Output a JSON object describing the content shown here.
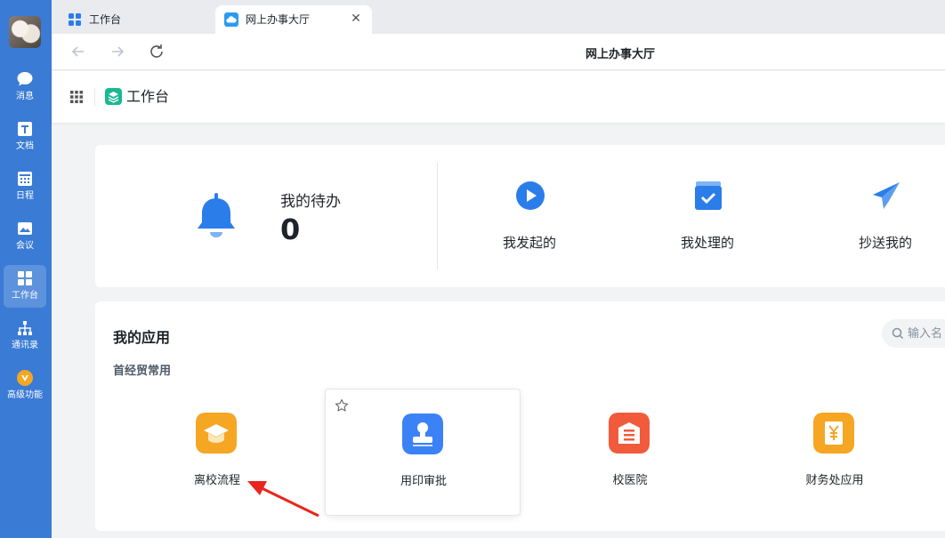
{
  "rail": {
    "items": [
      {
        "label": "消息",
        "icon": "chat-bubble-icon"
      },
      {
        "label": "文档",
        "icon": "document-icon"
      },
      {
        "label": "日程",
        "icon": "calendar-icon"
      },
      {
        "label": "会议",
        "icon": "meeting-icon"
      },
      {
        "label": "工作台",
        "icon": "workbench-grid-icon"
      },
      {
        "label": "通讯录",
        "icon": "org-chart-icon"
      },
      {
        "label": "高级功能",
        "icon": "premium-badge-icon"
      }
    ],
    "active_label": "工作台"
  },
  "tabs": [
    {
      "label": "工作台",
      "icon": "workbench-grid-icon"
    },
    {
      "label": "网上办事大厅",
      "icon": "cloud-icon"
    }
  ],
  "navbar": {
    "page_title": "网上办事大厅"
  },
  "header": {
    "title": "工作台"
  },
  "todo": {
    "label": "我的待办",
    "count": "0"
  },
  "quick_actions": [
    {
      "label": "我发起的",
      "icon": "play-circle-icon"
    },
    {
      "label": "我处理的",
      "icon": "check-box-icon"
    },
    {
      "label": "抄送我的",
      "icon": "paper-plane-icon"
    }
  ],
  "apps": {
    "title": "我的应用",
    "subtitle": "首经贸常用",
    "search_placeholder": "输入名",
    "items": [
      {
        "label": "离校流程",
        "icon": "graduation-cap-icon",
        "color": "#f5a623"
      },
      {
        "label": "用印审批",
        "icon": "seal-stamp-icon",
        "color": "#3b82f6"
      },
      {
        "label": "校医院",
        "icon": "hospital-icon",
        "color": "#f25a3c"
      },
      {
        "label": "财务处应用",
        "icon": "finance-yen-icon",
        "color": "#f5a623"
      }
    ]
  },
  "colors": {
    "rail": "#3a7bd5",
    "accent": "#2b7de9",
    "annotation_arrow": "#e8261f"
  }
}
